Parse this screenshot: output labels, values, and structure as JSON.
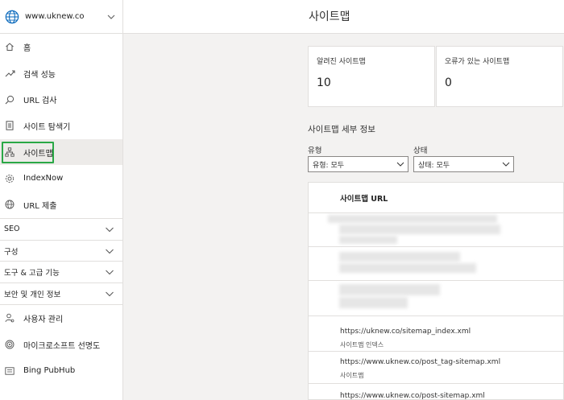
{
  "sidebar": {
    "site_name": "www.uknew.co",
    "items": [
      {
        "label": "홈",
        "icon": "home-icon"
      },
      {
        "label": "검색 성능",
        "icon": "trend-icon"
      },
      {
        "label": "URL 검사",
        "icon": "search-icon"
      },
      {
        "label": "사이트 탐색기",
        "icon": "document-icon"
      },
      {
        "label": "사이트맵",
        "icon": "sitemap-icon",
        "active": true
      },
      {
        "label": "IndexNow",
        "icon": "gear-icon"
      },
      {
        "label": "URL 제출",
        "icon": "globe-icon"
      }
    ],
    "sections": [
      {
        "label": "SEO"
      },
      {
        "label": "구성"
      },
      {
        "label": "도구 & 고급 기능"
      },
      {
        "label": "보안 및 개인 정보"
      }
    ],
    "bottom_items": [
      {
        "label": "사용자 관리",
        "icon": "user-icon"
      },
      {
        "label": "마이크로소프트 선명도",
        "icon": "clarity-icon"
      },
      {
        "label": "Bing PubHub",
        "icon": "pubhub-icon"
      }
    ]
  },
  "header": {
    "title": "사이트맵"
  },
  "stats": [
    {
      "label": "알려진 사이트맵",
      "value": "10"
    },
    {
      "label": "오류가 있는 사이트맵",
      "value": "0"
    }
  ],
  "details": {
    "title": "사이트맵 세부 정보",
    "filters": [
      {
        "label": "유형",
        "value": "유형: 모두"
      },
      {
        "label": "상태",
        "value": "상태: 모두"
      }
    ]
  },
  "table": {
    "header": "사이트맵 URL",
    "rows": [
      {
        "url": "https://uknew.co/sitemap_index.xml",
        "type": "사이트맵 인덱스"
      },
      {
        "url": "https://www.uknew.co/post_tag-sitemap.xml",
        "type": "사이트맵"
      },
      {
        "url": "https://www.uknew.co/post-sitemap.xml",
        "type": ""
      }
    ]
  },
  "colors": {
    "active_outline": "#2aa846",
    "brand_globe": "#0f6cbd"
  }
}
